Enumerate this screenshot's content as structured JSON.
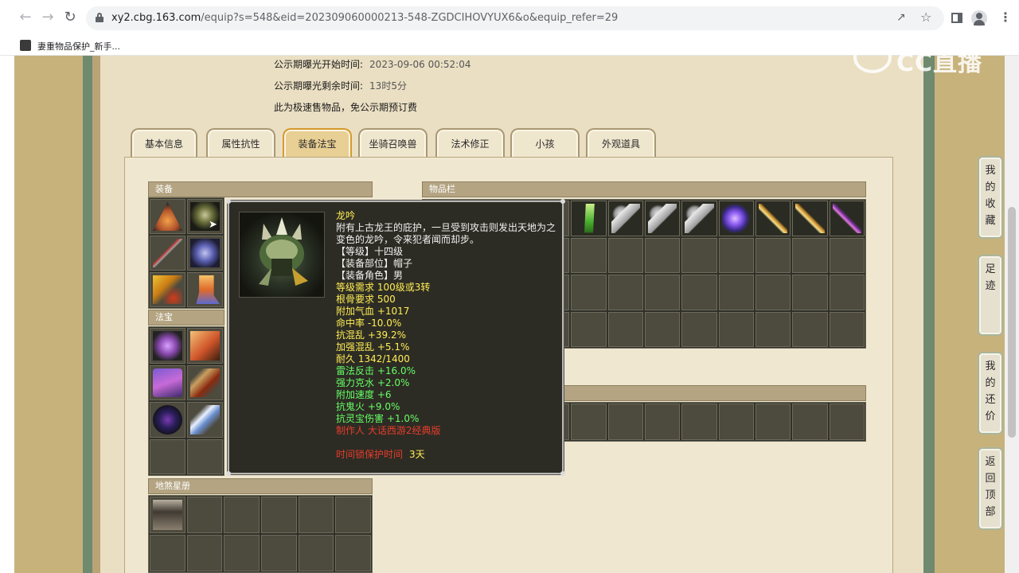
{
  "browser": {
    "url_host": "xy2.cbg.163.com",
    "url_path": "/equip?s=548&eid=202309060000213-548-ZGDCIHOVYUX6&o&equip_refer=29",
    "bookmark_label": "妻重物品保护_新手..."
  },
  "watermark": "CC直播",
  "header": {
    "line1_label": "公示期曝光开始时间:",
    "line1_value": "2023-09-06 00:52:04",
    "line2_label": "公示期曝光剩余时间:",
    "line2_value": "13时5分",
    "line3": "此为极速售物品，免公示期预订费"
  },
  "tabs": [
    {
      "label": "基本信息"
    },
    {
      "label": "属性抗性"
    },
    {
      "label": "装备法宝"
    },
    {
      "label": "坐骑召唤兽"
    },
    {
      "label": "法术修正"
    },
    {
      "label": "小孩"
    },
    {
      "label": "外观道具"
    }
  ],
  "sections": {
    "equipment": "装备",
    "treasure": "法宝",
    "inventory": "物品栏",
    "book": "地煞星册"
  },
  "tooltip": {
    "name": "龙吟",
    "desc": "附有上古龙王的庇护，一旦受到攻击则发出天地为之变色的龙吟，令来犯者闻而却步。",
    "level": "【等级】十四级",
    "slot": "【装备部位】帽子",
    "role": "【装备角色】男",
    "req_level": "等级需求 100级或3转",
    "req_bone": "根骨要求 500",
    "hp": "附加气血 +1017",
    "hit": "命中率 -10.0%",
    "resist_chaos": "抗混乱 +39.2%",
    "enh_chaos": "加强混乱 +5.1%",
    "durability": "耐久 1342/1400",
    "counter_thunder": "雷法反击 +16.0%",
    "counter_water": "强力克水 +2.0%",
    "speed": "附加速度 +6",
    "resist_ghostfire": "抗鬼火 +9.0%",
    "resist_treasure": "抗灵宝伤害 +1.0%",
    "maker": "制作人 大话西游2经典版",
    "protect_label": "时间锁保护时间",
    "protect_value": "3天"
  },
  "float_nav": [
    {
      "label": "我的收藏"
    },
    {
      "label": "足迹"
    },
    {
      "label": "我的还价"
    },
    {
      "label": "返回顶部"
    }
  ]
}
